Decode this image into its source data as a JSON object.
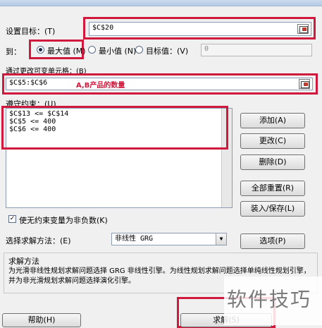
{
  "target": {
    "label": "设置目标：(T)",
    "value": "$C$20"
  },
  "to": {
    "label": "到：",
    "options": [
      "最大值 (M)",
      "最小值 (N)",
      "目标值：(V)"
    ],
    "selected": 0,
    "value": "0"
  },
  "changing": {
    "label": "通过更改可变单元格：(B)",
    "value": "$C$5:$C$6",
    "annotation": "A,B产品的数量"
  },
  "constraints": {
    "label": "遵守约束：(U)",
    "items": [
      "$C$13 <= $C$14",
      "$C$5 <= 400",
      "$C$6 <= 400"
    ]
  },
  "buttons": {
    "add": "添加(A)",
    "change": "更改(C)",
    "delete": "删除(D)",
    "reset": "全部重置(R)",
    "load_save": "装入/保存(L)",
    "options": "选项(P)",
    "help": "帮助(H)",
    "solve": "求解(S)"
  },
  "nonneg": {
    "label": "使无约束变量为非负数(K)",
    "checked": true,
    "mark": "✓"
  },
  "method": {
    "label": "选择求解方法：(E)",
    "value": "非线性 GRG",
    "arrow": "▼"
  },
  "solve_method": {
    "title": "求解方法",
    "text": "为光滑非线性规划求解问题选择 GRG 非线性引擎。为线性规划求解问题选择单纯线性规划引擎，并为非光滑规划求解问题选择演化引擎。"
  },
  "watermark": "软件技巧"
}
